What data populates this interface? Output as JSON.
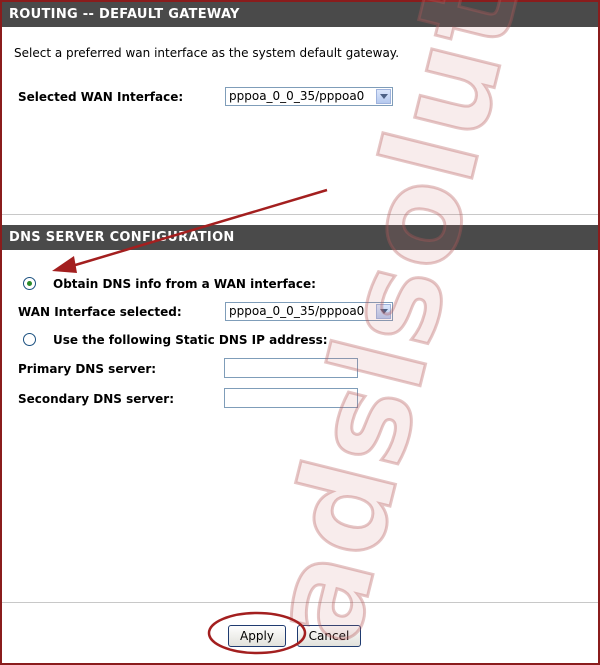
{
  "routing": {
    "header": "ROUTING -- DEFAULT GATEWAY",
    "description": "Select a preferred wan interface as the system default gateway.",
    "wan_label": "Selected WAN Interface:",
    "wan_value": "pppoa_0_0_35/pppoa0"
  },
  "dns": {
    "header": "DNS SERVER CONFIGURATION",
    "option_wan_label": "Obtain DNS info from a WAN interface:",
    "option_wan_checked": true,
    "wan_selected_label": "WAN Interface selected:",
    "wan_selected_value": "pppoa_0_0_35/pppoa0",
    "option_static_label": "Use the following Static DNS IP address:",
    "primary_label": "Primary DNS server:",
    "primary_value": "",
    "secondary_label": "Secondary DNS server:",
    "secondary_value": ""
  },
  "buttons": {
    "apply": "Apply",
    "cancel": "Cancel"
  },
  "watermark": "adslsolution",
  "colors": {
    "header_bg": "#4a4a4a",
    "frame": "#8a1c1c",
    "annotation": "#a31f1f"
  }
}
